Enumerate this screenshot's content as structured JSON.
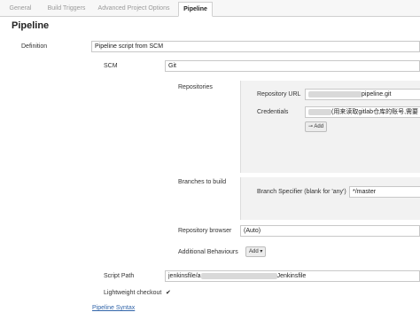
{
  "tabs": [
    {
      "label": "General"
    },
    {
      "label": "Build Triggers"
    },
    {
      "label": "Advanced Project Options"
    },
    {
      "label": "Pipeline"
    }
  ],
  "section_title": "Pipeline",
  "definition": {
    "label": "Definition",
    "value": "Pipeline script from SCM"
  },
  "scm": {
    "label": "SCM",
    "value": "Git"
  },
  "repositories": {
    "label": "Repositories",
    "repo_url": {
      "label": "Repository URL",
      "value_suffix": "pipeline.git"
    },
    "credentials": {
      "label": "Credentials",
      "value": "(用来读取gitlab仓库的账号,需要",
      "add_label": "Add"
    }
  },
  "branches": {
    "label": "Branches to build",
    "specifier": {
      "label": "Branch Specifier (blank for 'any')",
      "value": "*/master"
    }
  },
  "repo_browser": {
    "label": "Repository browser",
    "value": "(Auto)"
  },
  "additional_behaviours": {
    "label": "Additional Behaviours",
    "add_label": "Add"
  },
  "script_path": {
    "label": "Script Path",
    "value_prefix": "jenkinsfile/a",
    "value_suffix": "Jenkinsfile"
  },
  "lightweight_checkout": {
    "label": "Lightweight checkout",
    "checked": "✔"
  },
  "pipeline_syntax": {
    "label": "Pipeline Syntax"
  }
}
